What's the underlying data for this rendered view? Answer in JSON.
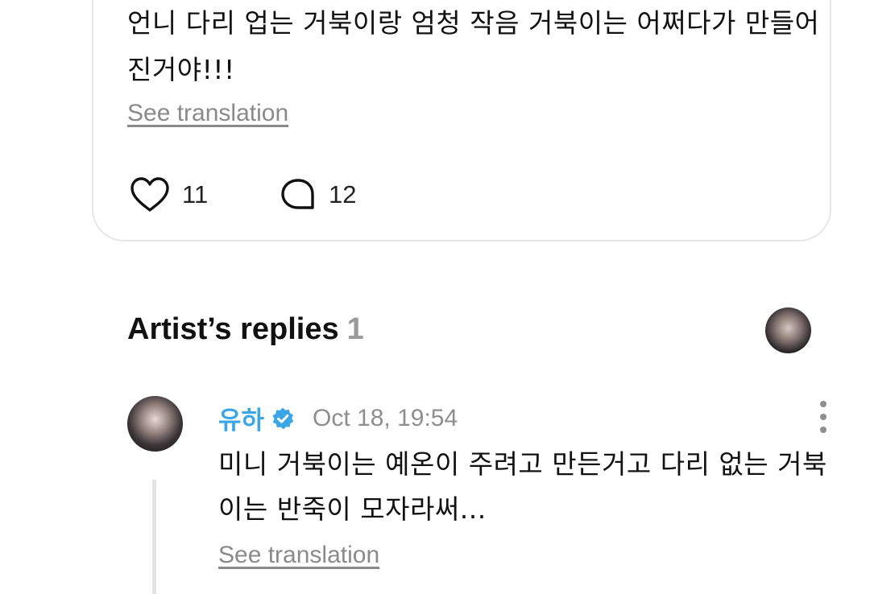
{
  "comment": {
    "text": "언니 다리 업는 거북이랑 엄청 작음 거북이는 어쩌다가 만들어진거야!!!",
    "see_translation": "See translation",
    "likes": "11",
    "replies": "12",
    "icons": {
      "like": "heart-outline-icon",
      "reply": "speech-bubble-icon"
    }
  },
  "artist_replies": {
    "title": "Artist’s replies",
    "count": "1",
    "reply": {
      "author": "유하",
      "verified_icon": "verified-badge-icon",
      "timestamp": "Oct 18, 19:54",
      "text": "미니 거북이는 예온이 주려고 만든거고 다리 없는 거북이는 반죽이 모자라써...",
      "see_translation": "See translation",
      "more_icon": "more-vertical-icon"
    }
  },
  "colors": {
    "author_name": "#3aa6e6",
    "verified_badge": "#3aa6e6",
    "muted_text": "#8e8e8e",
    "card_border": "#e6e6e6"
  }
}
